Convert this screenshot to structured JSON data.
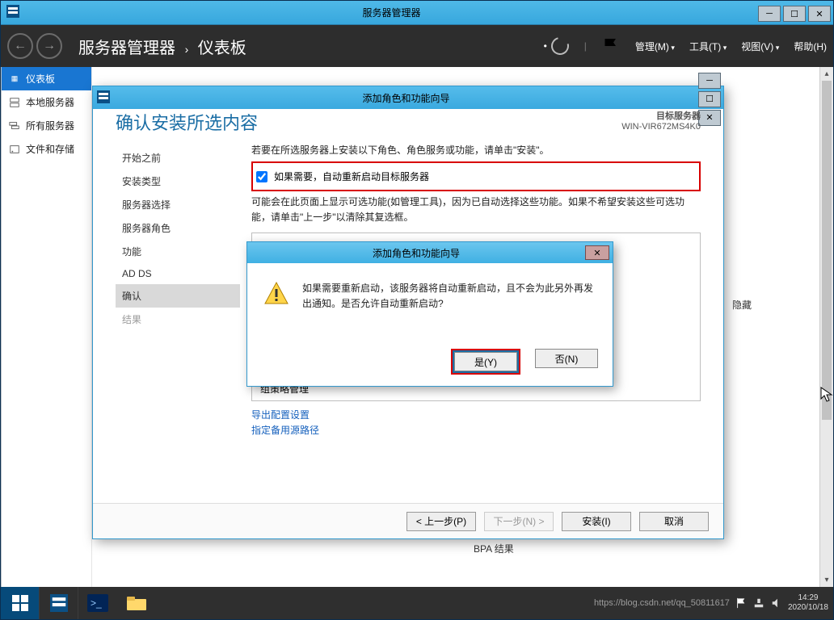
{
  "outer": {
    "title": "服务器管理器"
  },
  "winCtrls": {
    "min": "─",
    "max": "☐",
    "close": "✕"
  },
  "header": {
    "app": "服务器管理器",
    "crumb": "仪表板",
    "menu": {
      "manage": "管理(M)",
      "tools": "工具(T)",
      "view": "视图(V)",
      "help": "帮助(H)"
    }
  },
  "nav": {
    "dashboard": "仪表板",
    "local": "本地服务器",
    "all": "所有服务器",
    "files": "文件和存储"
  },
  "wizard": {
    "title": "添加角色和功能向导",
    "heading": "确认安装所选内容",
    "srvLabel": "目标服务器",
    "srvName": "WIN-VIR672MS4K0",
    "intro": "若要在所选服务器上安装以下角色、角色服务或功能，请单击\"安装\"。",
    "checkbox": "如果需要，自动重新启动目标服务器",
    "note": "可能会在此页面上显示可选功能(如管理工具)，因为已自动选择这些功能。如果不希望安装这些可选功能，请单击\"上一步\"以清除其复选框。",
    "feature": "组策略管理",
    "hide": "隐藏",
    "link1": "导出配置设置",
    "link2": "指定备用源路径",
    "steps": {
      "before": "开始之前",
      "type": "安装类型",
      "serverSel": "服务器选择",
      "serverRole": "服务器角色",
      "features": "功能",
      "adds": "AD DS",
      "confirm": "确认",
      "result": "结果"
    },
    "buttons": {
      "prev": "< 上一步(P)",
      "next": "下一步(N) >",
      "install": "安装(I)",
      "cancel": "取消"
    }
  },
  "msg": {
    "title": "添加角色和功能向导",
    "text": "如果需要重新启动，该服务器将自动重新启动，且不会为此另外再发出通知。是否允许自动重新启动?",
    "yes": "是(Y)",
    "no": "否(N)"
  },
  "bpa": "BPA 结果",
  "taskbar": {
    "watermark": "https://blog.csdn.net/qq_50811617",
    "time": "14:29",
    "date": "2020/10/18"
  }
}
